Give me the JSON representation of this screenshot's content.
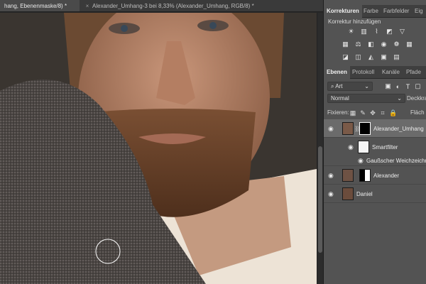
{
  "document_tabs": [
    {
      "label": "hang, Ebenenmaske/8) *",
      "close": "×"
    },
    {
      "label": "Alexander_Umhang-3 bei 8,33% (Alexander_Umhang, RGB/8) *",
      "close": "×"
    }
  ],
  "top_panel": {
    "tabs": [
      "Korrekturen",
      "Farbe",
      "Farbfelder",
      "Eig"
    ],
    "adjustments_title": "Korrektur hinzufügen",
    "adjustment_icons": [
      "brightness-icon",
      "levels-icon",
      "curves-icon",
      "exposure-icon",
      "triangle-icon",
      "vibrance-icon",
      "hue-icon",
      "color-balance-icon",
      "black-white-icon",
      "photo-filter-icon",
      "channel-mixer-icon",
      "color-lookup-icon",
      "invert-icon",
      "posterize-icon",
      "threshold-icon",
      "selective-color-icon",
      "gradient-map-icon"
    ]
  },
  "layers_panel": {
    "tabs": [
      "Ebenen",
      "Protokoll",
      "Kanäle",
      "Pfade"
    ],
    "filter_kind": "Art",
    "blend_mode": "Normal",
    "opacity_label": "Deckkraft",
    "lock_label": "Fixieren:",
    "fill_label": "Fläch",
    "layers": [
      {
        "name": "Alexander_Umhang",
        "selected": true,
        "visible": true
      },
      {
        "name": "Smartfilter",
        "visible": true
      },
      {
        "name": "Gaußscher Weichzeichner",
        "visible": true
      },
      {
        "name": "Alexander",
        "visible": true
      },
      {
        "name": "Daniel",
        "visible": true
      }
    ]
  },
  "colors": {
    "panel_bg": "#535353",
    "selected_row": "#6b6b6b",
    "tab_bar": "#3a3a3a"
  }
}
